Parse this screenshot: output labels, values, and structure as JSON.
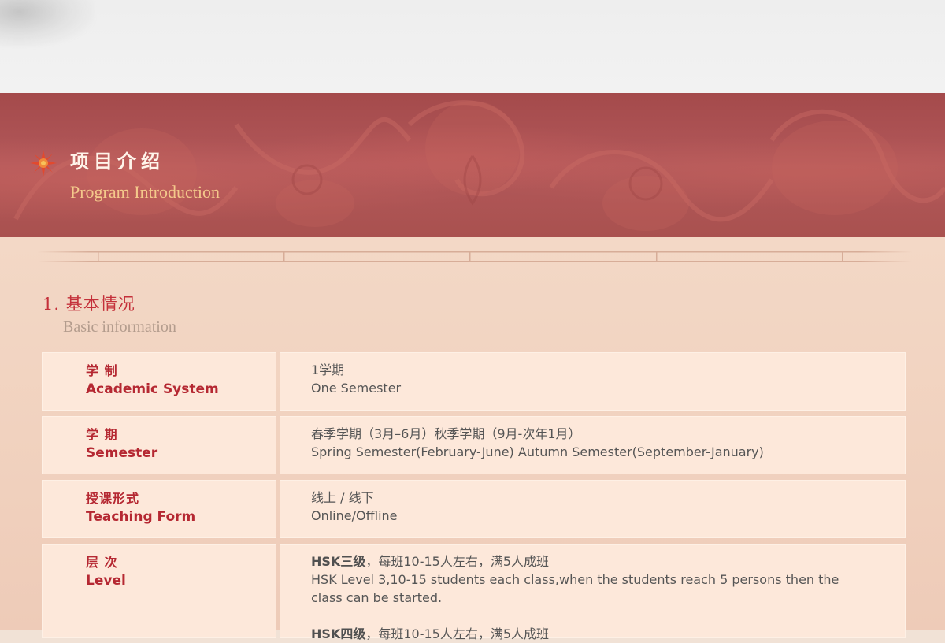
{
  "banner": {
    "title_cn": "项目介绍",
    "title_en": "Program Introduction"
  },
  "section": {
    "title_cn": "1. 基本情况",
    "title_en": "Basic information"
  },
  "rows": [
    {
      "label_cn": "学 制",
      "label_en": "Academic System",
      "value_cn": "1学期",
      "value_en": "One Semester"
    },
    {
      "label_cn": "学 期",
      "label_en": "Semester",
      "value_cn": "春季学期（3月–6月）秋季学期（9月-次年1月）",
      "value_en": "Spring Semester(February-June) Autumn Semester(September-January)"
    },
    {
      "label_cn": "授课形式",
      "label_en": "Teaching Form",
      "value_cn": "线上 / 线下",
      "value_en": "Online/Offline"
    },
    {
      "label_cn": "层 次",
      "label_en": "Level",
      "value_bold": "HSK三级",
      "value_cn": "，每班10-15人左右，满5人成班",
      "value_en": "HSK Level 3,10-15 students each class,when the students reach 5 persons then the class can be started.",
      "value2_bold": "HSK四级",
      "value2_cn": "，每班10-15人左右，满5人成班"
    }
  ],
  "colors": {
    "label_red": "#b52832",
    "section_red": "#c4303a",
    "banner_gold": "#f4c98b",
    "cell_bg": "#fde8da"
  }
}
